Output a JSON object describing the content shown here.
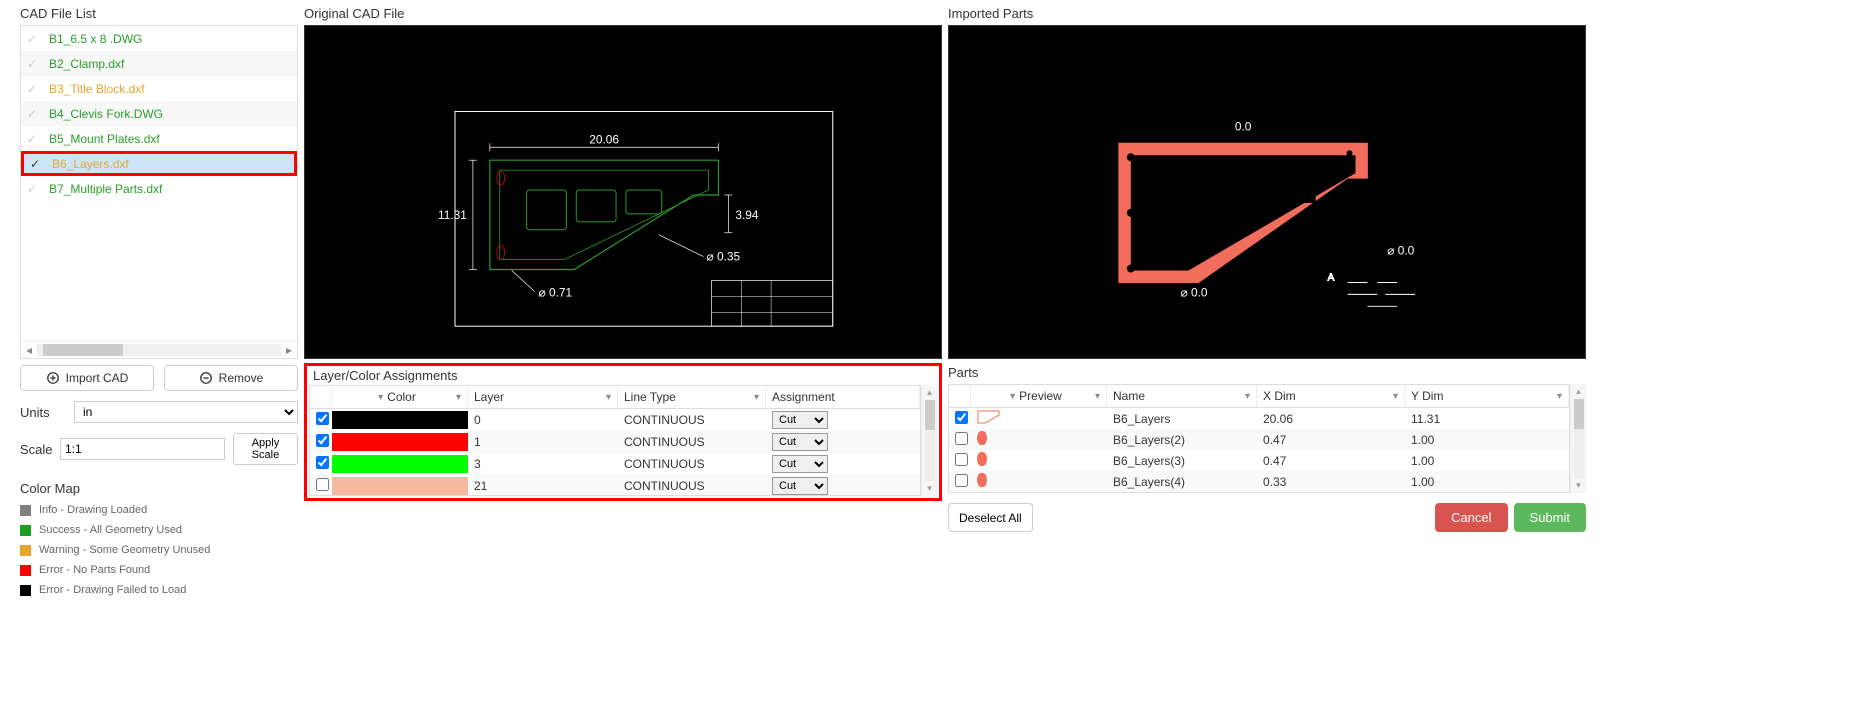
{
  "left": {
    "title": "CAD File List",
    "files": [
      {
        "name": "B1_6.5 x 8 .DWG",
        "status": "success",
        "selected": false
      },
      {
        "name": "B2_Clamp.dxf",
        "status": "success",
        "selected": false
      },
      {
        "name": "B3_Title Block.dxf",
        "status": "warning",
        "selected": false
      },
      {
        "name": "B4_Clevis Fork.DWG",
        "status": "success",
        "selected": false
      },
      {
        "name": "B5_Mount Plates.dxf",
        "status": "success",
        "selected": false
      },
      {
        "name": "B6_Layers.dxf",
        "status": "warning",
        "selected": true
      },
      {
        "name": "B7_Multiple Parts.dxf",
        "status": "success",
        "selected": false
      }
    ],
    "import_btn": "Import CAD",
    "remove_btn": "Remove",
    "units_label": "Units",
    "units_value": "in",
    "scale_label": "Scale",
    "scale_value": "1:1",
    "apply_scale": "Apply Scale",
    "color_map_title": "Color Map",
    "legend": [
      {
        "color": "#808080",
        "label": "Info - Drawing Loaded"
      },
      {
        "color": "#1e9e1e",
        "label": "Success - All Geometry Used"
      },
      {
        "color": "#e7a52f",
        "label": "Warning - Some Geometry Unused"
      },
      {
        "color": "#ff0000",
        "label": "Error - No Parts Found"
      },
      {
        "color": "#000000",
        "label": "Error - Drawing Failed to Load"
      }
    ]
  },
  "middle": {
    "title": "Original CAD File",
    "dims": {
      "w": "20.06",
      "h": "11.31",
      "r": "3.94",
      "d1": "0.35",
      "d2": "0.71"
    },
    "layer_title": "Layer/Color Assignments",
    "headers": {
      "color": "Color",
      "layer": "Layer",
      "linetype": "Line Type",
      "assignment": "Assignment"
    },
    "rows": [
      {
        "checked": true,
        "color": "#000000",
        "layer": "0",
        "linetype": "CONTINUOUS",
        "assignment": "Cut"
      },
      {
        "checked": true,
        "color": "#ff0000",
        "layer": "1",
        "linetype": "CONTINUOUS",
        "assignment": "Cut"
      },
      {
        "checked": true,
        "color": "#00ff00",
        "layer": "3",
        "linetype": "CONTINUOUS",
        "assignment": "Cut"
      },
      {
        "checked": false,
        "color": "#f5b9a0",
        "layer": "21",
        "linetype": "CONTINUOUS",
        "assignment": "Cut"
      }
    ]
  },
  "right": {
    "title": "Imported Parts",
    "dims": {
      "top": "0.0",
      "side": "0.0",
      "bottom": "0.0"
    },
    "parts_title": "Parts",
    "headers": {
      "preview": "Preview",
      "name": "Name",
      "xdim": "X Dim",
      "ydim": "Y Dim"
    },
    "rows": [
      {
        "checked": true,
        "name": "B6_Layers",
        "xdim": "20.06",
        "ydim": "11.31",
        "big": true
      },
      {
        "checked": false,
        "name": "B6_Layers(2)",
        "xdim": "0.47",
        "ydim": "1.00",
        "big": false
      },
      {
        "checked": false,
        "name": "B6_Layers(3)",
        "xdim": "0.47",
        "ydim": "1.00",
        "big": false
      },
      {
        "checked": false,
        "name": "B6_Layers(4)",
        "xdim": "0.33",
        "ydim": "1.00",
        "big": false
      }
    ],
    "deselect": "Deselect All",
    "cancel": "Cancel",
    "submit": "Submit"
  },
  "diam_prefix": "⌀ "
}
